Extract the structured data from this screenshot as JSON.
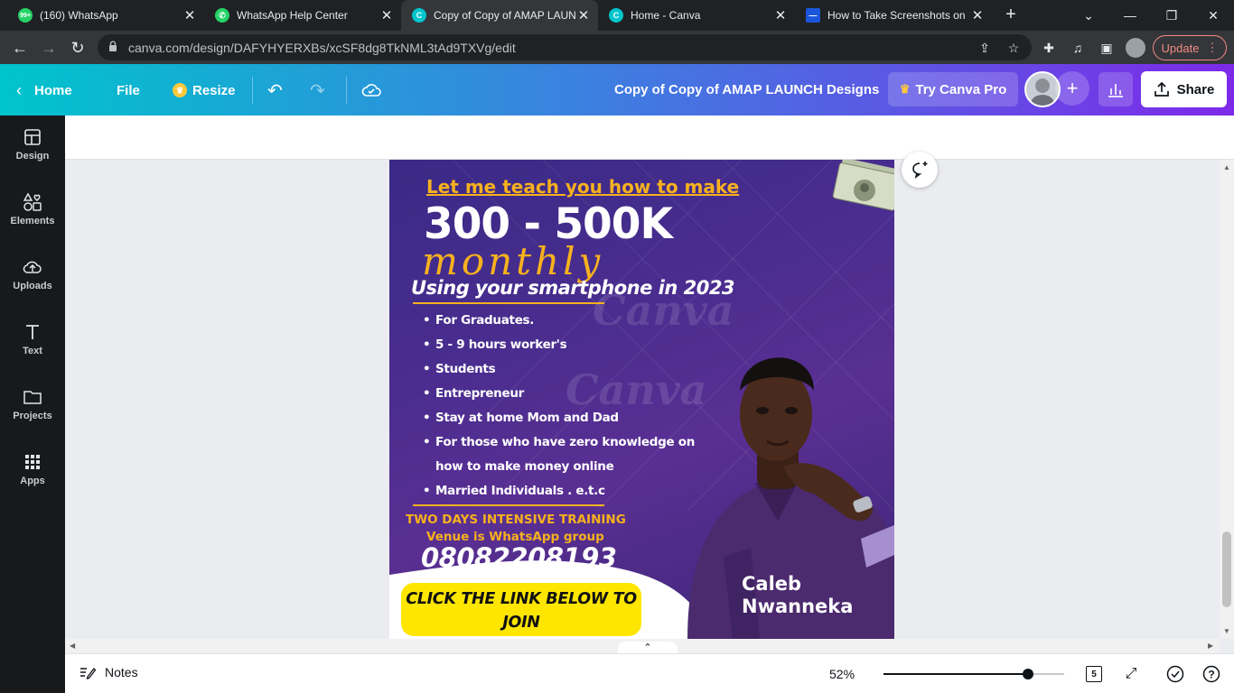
{
  "browser": {
    "tabs": [
      {
        "title": "(160) WhatsApp",
        "favicon_badge": "99+"
      },
      {
        "title": "WhatsApp Help Center"
      },
      {
        "title": "Copy of Copy of AMAP LAUN"
      },
      {
        "title": "Home - Canva"
      },
      {
        "title": "How to Take Screenshots on"
      }
    ],
    "url": "canva.com/design/DAFYHYERXBs/xcSF8dg8TkNML3tAd9TXVg/edit",
    "update_label": "Update"
  },
  "canva_header": {
    "home_label": "Home",
    "file_label": "File",
    "resize_label": "Resize",
    "doc_title": "Copy of Copy of AMAP LAUNCH Designs",
    "try_pro_label": "Try Canva Pro",
    "share_label": "Share"
  },
  "sidebar": {
    "items": [
      {
        "label": "Design",
        "icon": "design-icon"
      },
      {
        "label": "Elements",
        "icon": "elements-icon"
      },
      {
        "label": "Uploads",
        "icon": "uploads-icon"
      },
      {
        "label": "Text",
        "icon": "text-icon"
      },
      {
        "label": "Projects",
        "icon": "projects-icon"
      },
      {
        "label": "Apps",
        "icon": "apps-icon"
      }
    ]
  },
  "design": {
    "teach_line": "Let me teach you how to make",
    "big_line": "300 - 500K",
    "script_line": "monthly",
    "sub_line": "Using your smartphone in 2023",
    "bullets": [
      "For  Graduates.",
      "5 - 9 hours worker's",
      "Students",
      "Entrepreneur",
      "Stay at home Mom and Dad",
      "For those who have zero knowledge  on",
      "how to make money online",
      "Married Individuals . e.t.c"
    ],
    "training": "TWO DAYS INTENSIVE TRAINING",
    "venue": "Venue is WhatsApp  group",
    "phone": "08082208193",
    "cta_line1": "CLICK THE LINK BELOW TO",
    "cta_line2": "JOIN",
    "name_line1": "Caleb",
    "name_line2": "Nwanneka",
    "watermark": "Canva",
    "colors": {
      "accent": "#f7b11e",
      "cta": "#ffe600",
      "bg_dark": "#3a2a86",
      "bg_mid": "#5a2f93"
    }
  },
  "bottom_bar": {
    "notes_label": "Notes",
    "zoom_percent": 52,
    "zoom_label": "52%",
    "page_count": "5"
  }
}
